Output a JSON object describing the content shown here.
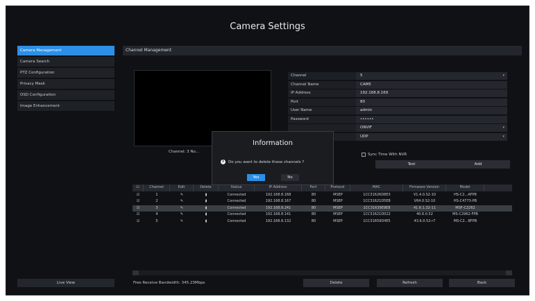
{
  "window": {
    "title": "Camera Settings"
  },
  "sidebar": {
    "items": [
      {
        "label": "Camera Management",
        "active": true
      },
      {
        "label": "Camera Search",
        "active": false
      },
      {
        "label": "PTZ Configuration",
        "active": false
      },
      {
        "label": "Privacy Mask",
        "active": false
      },
      {
        "label": "OSD Configuration",
        "active": false
      },
      {
        "label": "Image Enhancement",
        "active": false
      }
    ],
    "live_view_label": "Live View"
  },
  "content": {
    "header": "Channel Management",
    "preview_label": "Channel: 3 No..."
  },
  "form": {
    "rows": [
      {
        "label": "Channel",
        "value": "5",
        "dropdown": true
      },
      {
        "label": "Channel Name",
        "value": "CAM5",
        "dropdown": false
      },
      {
        "label": "IP Address",
        "value": "192.168.8.169",
        "dropdown": false
      },
      {
        "label": "Port",
        "value": "80",
        "dropdown": false
      },
      {
        "label": "User Name",
        "value": "admin",
        "dropdown": false
      },
      {
        "label": "Password",
        "value": "••••••",
        "dropdown": false
      },
      {
        "label": "",
        "value": "ONVIF",
        "dropdown": true
      },
      {
        "label": "",
        "value": "UDP",
        "dropdown": true
      }
    ],
    "sync_label": "Sync Time With NVR",
    "test_label": "Test",
    "add_label": "Add"
  },
  "table": {
    "columns": [
      "",
      "Channel",
      "Edit",
      "Delete",
      "Status",
      "IP Address",
      "Port",
      "Protocol",
      "MAC",
      "Firmware Version",
      "Model"
    ],
    "rows": [
      {
        "check": "☑",
        "channel": "1",
        "status": "Connected",
        "ip": "192.168.8.168",
        "port": "80",
        "protocol": "MSEP",
        "mac": "1CC31626D8E3",
        "fw": "V1.4.0.S2-10",
        "model": "HS-C2...AFP8",
        "selected": false
      },
      {
        "check": "☑",
        "channel": "2",
        "status": "Connected",
        "ip": "192.168.8.167",
        "port": "80",
        "protocol": "MSEP",
        "mac": "1CC31621D5E8",
        "fw": "V64.0.S2-10",
        "model": "HS-C4773-PB",
        "selected": false
      },
      {
        "check": "☑",
        "channel": "3",
        "status": "Connected",
        "ip": "192.168.8.241",
        "port": "80",
        "protocol": "MSEP",
        "mac": "1CC31639E9E8",
        "fw": "41.6.1.32-11",
        "model": "MSF-C2262",
        "selected": true
      },
      {
        "check": "☑",
        "channel": "4",
        "status": "Connected",
        "ip": "192.168.8.141",
        "port": "80",
        "protocol": "MSEP",
        "mac": "1CC31621D022",
        "fw": "40.6.0.52",
        "model": "MS-C2962-FPB",
        "selected": false
      },
      {
        "check": "☑",
        "channel": "5",
        "status": "Connected",
        "ip": "192.168.8.132",
        "port": "80",
        "protocol": "MSEP",
        "mac": "1CC31659D4E5",
        "fw": "43.6.0.52-r7",
        "model": "MS-C2...BFPB",
        "selected": false
      }
    ]
  },
  "bottom": {
    "bandwidth_text": "Free Receive Bandwidth: 345.23Mbps",
    "delete_label": "Delete",
    "refresh_label": "Refresh",
    "back_label": "Back"
  },
  "modal": {
    "title": "Information",
    "message": "Do you want to delete these channels ?",
    "yes_label": "Yes",
    "no_label": "No"
  },
  "colors": {
    "accent": "#2d8fe6",
    "background": "#101114"
  },
  "icons": {
    "edit": "edit-icon",
    "delete": "trash-icon",
    "info": "info-icon"
  }
}
